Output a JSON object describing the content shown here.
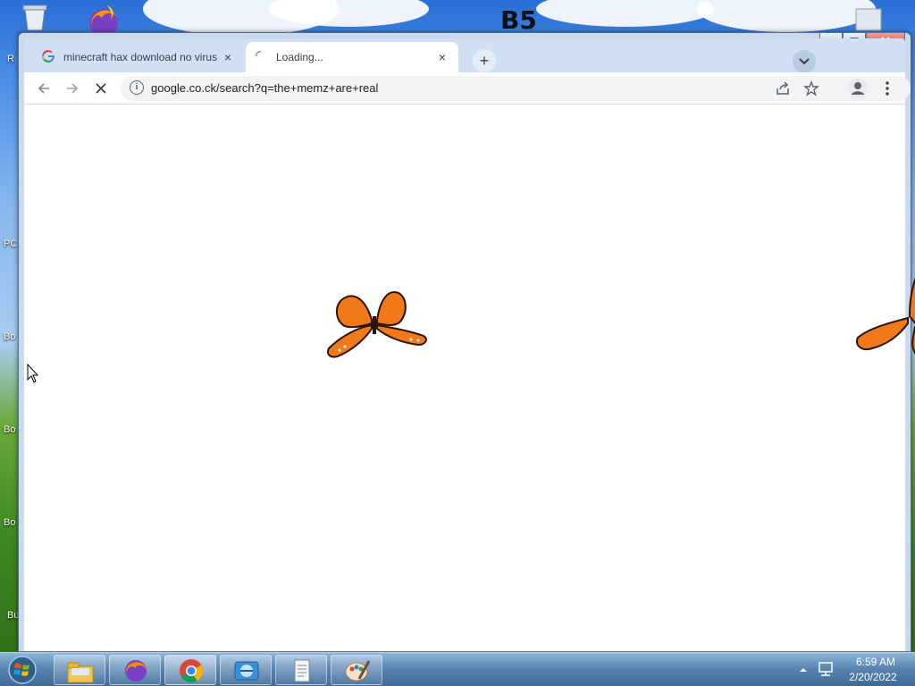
{
  "desktop": {
    "edge_labels": [
      "R",
      "PC",
      "Bo",
      "Bo",
      "Bo",
      "Bu"
    ],
    "scribble_text": "B5"
  },
  "browser": {
    "tabs": [
      {
        "title": "minecraft hax download no virus",
        "state": "inactive",
        "favicon": "google-favicon-icon"
      },
      {
        "title": "Loading...",
        "state": "active",
        "favicon": "loading-spinner-icon"
      }
    ],
    "tab_close_glyph": "×",
    "new_tab_glyph": "+",
    "omnibox": {
      "url": "google.co.ck/search?q=the+memz+are+real"
    }
  },
  "taskbar": {
    "apps": [
      {
        "name": "file-explorer-icon"
      },
      {
        "name": "firefox-icon"
      },
      {
        "name": "chrome-icon"
      },
      {
        "name": "internet-explorer-icon"
      },
      {
        "name": "notepad-icon"
      },
      {
        "name": "paint-icon"
      }
    ],
    "clock": {
      "time": "6:59 AM",
      "date": "2/20/2022"
    }
  },
  "colors": {
    "butterfly_wing": "#f07a1a",
    "butterfly_vein": "#2a1406",
    "chrome_frame": "#cfe0f5",
    "omnibox_bg": "#f1f3f4"
  }
}
